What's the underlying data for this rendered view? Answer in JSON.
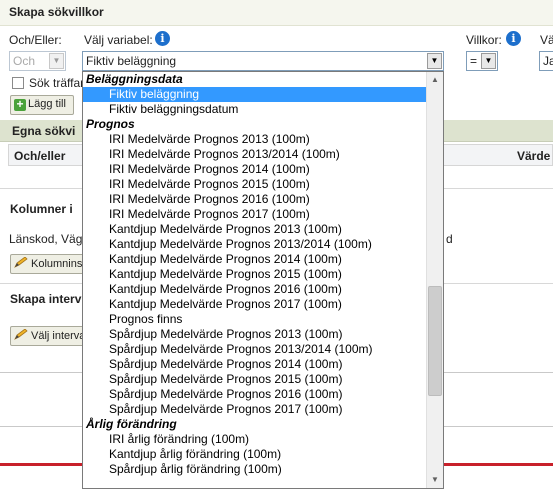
{
  "section": {
    "title": "Skapa sökvillkor"
  },
  "labels": {
    "och_eller": "Och/Eller:",
    "valj_variabel": "Välj variabel:",
    "villkor": "Villkor:",
    "value_partial": "Vä"
  },
  "och_eller_select": {
    "value": "Och"
  },
  "variable_select": {
    "value": "Fiktiv beläggning"
  },
  "villkor_select": {
    "value": "="
  },
  "value_select": {
    "value": "Ja"
  },
  "checkbox": {
    "label": "Sök träffar"
  },
  "add_button": {
    "label": "Lägg till"
  },
  "egna_sokvillkor": {
    "title": "Egna sökvi",
    "columns": [
      "Och/eller",
      "Värde"
    ]
  },
  "kolumner": {
    "heading": "Kolumner i",
    "list_text": "Länskod, Väg",
    "list_text_end": "d",
    "button": "Kolumnins"
  },
  "intervall": {
    "heading": "Skapa interv",
    "button": "Välj interva"
  },
  "icons": {
    "info": "info-icon",
    "add": "plus-icon",
    "edit": "pencil-icon",
    "dropdown": "chevron-down-icon"
  },
  "colors": {
    "selection": "#3399ff",
    "red_rule": "#c8202a",
    "egna_bar": "#dde3cf",
    "info_blue": "#1d6fcc"
  },
  "dropdown": {
    "groups": [
      {
        "label": "Beläggningsdata",
        "options": [
          "Fiktiv beläggning",
          "Fiktiv beläggningsdatum"
        ]
      },
      {
        "label": "Prognos",
        "options": [
          "IRI Medelvärde Prognos 2013 (100m)",
          "IRI Medelvärde Prognos 2013/2014 (100m)",
          "IRI Medelvärde Prognos 2014 (100m)",
          "IRI Medelvärde Prognos 2015 (100m)",
          "IRI Medelvärde Prognos 2016 (100m)",
          "IRI Medelvärde Prognos 2017 (100m)",
          "Kantdjup Medelvärde Prognos 2013 (100m)",
          "Kantdjup Medelvärde Prognos 2013/2014 (100m)",
          "Kantdjup Medelvärde Prognos 2014 (100m)",
          "Kantdjup Medelvärde Prognos 2015 (100m)",
          "Kantdjup Medelvärde Prognos 2016 (100m)",
          "Kantdjup Medelvärde Prognos 2017 (100m)",
          "Prognos finns",
          "Spårdjup Medelvärde Prognos 2013 (100m)",
          "Spårdjup Medelvärde Prognos 2013/2014 (100m)",
          "Spårdjup Medelvärde Prognos 2014 (100m)",
          "Spårdjup Medelvärde Prognos 2015 (100m)",
          "Spårdjup Medelvärde Prognos 2016 (100m)",
          "Spårdjup Medelvärde Prognos 2017 (100m)"
        ]
      },
      {
        "label": "Årlig förändring",
        "options": [
          "IRI årlig förändring (100m)",
          "Kantdjup årlig förändring (100m)",
          "Spårdjup årlig förändring (100m)"
        ]
      }
    ],
    "selected": "Fiktiv beläggning"
  }
}
